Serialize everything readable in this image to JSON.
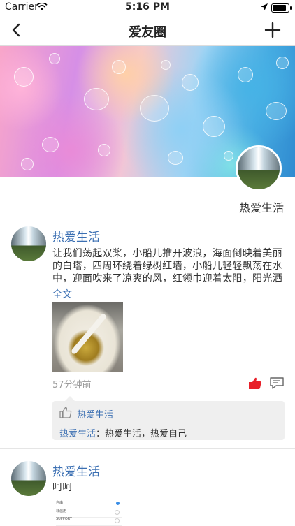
{
  "status_bar": {
    "carrier": "Carrier",
    "time": "5:16 PM"
  },
  "navbar": {
    "title": "爱友圈",
    "back_icon": "chevron-left-icon",
    "add_icon": "plus-icon"
  },
  "profile": {
    "name": "热爱生活"
  },
  "posts": [
    {
      "author": "热爱生活",
      "text": "让我们荡起双桨，小船儿推开波浪，海面倒映着美丽的白塔，四周环绕着绿树红墙，小船儿轻轻飘荡在水中，迎面吹来了凉爽的风，红领巾迎着太阳，阳光洒在海面",
      "full_text_label": "全文",
      "time": "57分钟前",
      "likes": [
        "热爱生活"
      ],
      "comments": [
        {
          "author": "热爱生活",
          "separator": "：",
          "content": "热爱生活，热爱自己"
        }
      ],
      "like_icon_color": "#e8202a"
    },
    {
      "author": "热爱生活",
      "text": "呵呵",
      "settings_rows": [
        "自由",
        "非滥用",
        "SUPPORT"
      ]
    }
  ],
  "colors": {
    "link_blue": "#3c70b3",
    "like_red": "#e8202a",
    "comment_bg": "#efefef"
  }
}
